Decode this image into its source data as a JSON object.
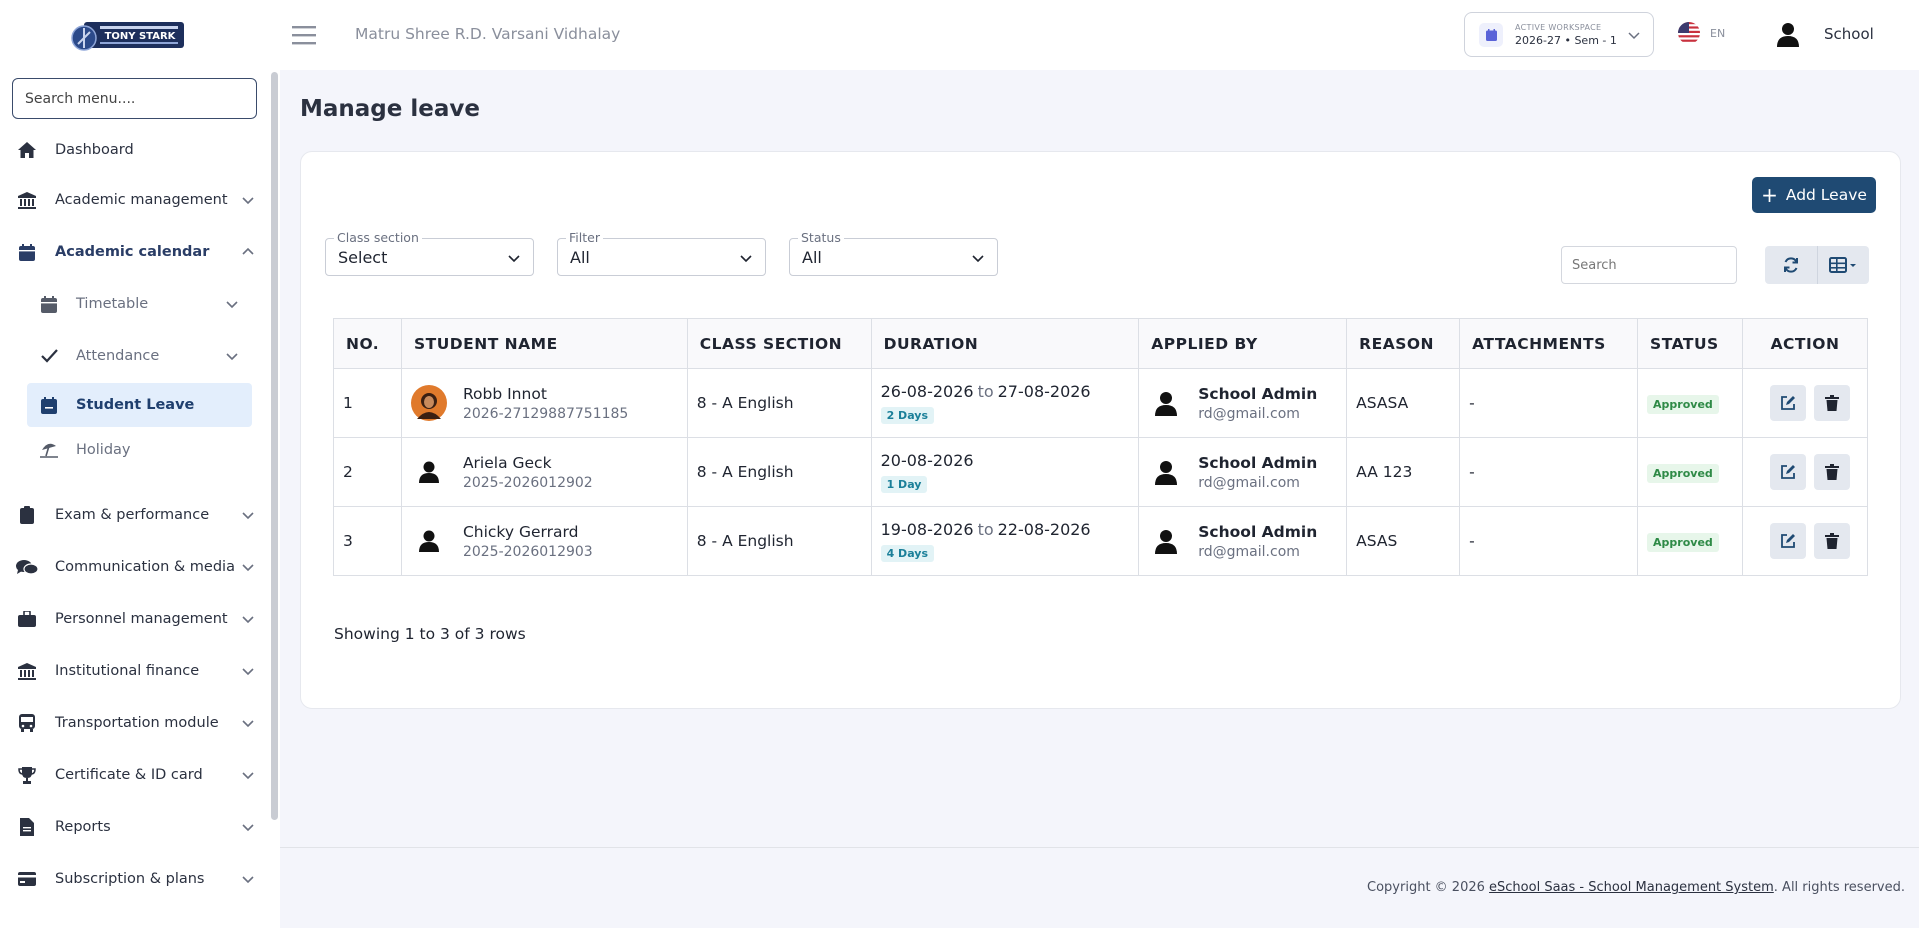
{
  "sidebar": {
    "logo_text": "TONY STARK",
    "search_placeholder": "Search menu....",
    "items": [
      {
        "label": "Dashboard",
        "icon": "home-icon"
      },
      {
        "label": "Academic management",
        "icon": "bank-icon"
      },
      {
        "label": "Academic calendar",
        "icon": "calendar-icon"
      },
      {
        "label": "Exam & performance",
        "icon": "clipboard-icon"
      },
      {
        "label": "Communication & media",
        "icon": "chat-icon"
      },
      {
        "label": "Personnel management",
        "icon": "briefcase-icon"
      },
      {
        "label": "Institutional finance",
        "icon": "bank-icon"
      },
      {
        "label": "Transportation module",
        "icon": "bus-icon"
      },
      {
        "label": "Certificate & ID card",
        "icon": "trophy-icon"
      },
      {
        "label": "Reports",
        "icon": "document-icon"
      },
      {
        "label": "Subscription & plans",
        "icon": "credit-card-icon"
      }
    ],
    "sub_items": [
      {
        "label": "Timetable",
        "icon": "calendar-icon"
      },
      {
        "label": "Attendance",
        "icon": "check-icon"
      },
      {
        "label": "Student Leave",
        "icon": "calendar-leave-icon"
      },
      {
        "label": "Holiday",
        "icon": "umbrella-beach-icon"
      }
    ]
  },
  "topbar": {
    "school_name": "Matru Shree R.D. Varsani Vidhalay",
    "workspace_label": "ACTIVE WORKSPACE",
    "workspace_value": "2026-27 • Sem - 1",
    "language": "EN",
    "user_name": "School"
  },
  "main": {
    "title": "Manage leave",
    "add_button": "Add Leave",
    "filters": [
      {
        "label": "Class section",
        "value": "Select"
      },
      {
        "label": "Filter",
        "value": "All"
      },
      {
        "label": "Status",
        "value": "All"
      }
    ],
    "search_placeholder": "Search",
    "columns": [
      "NO.",
      "STUDENT NAME",
      "CLASS SECTION",
      "DURATION",
      "APPLIED BY",
      "REASON",
      "ATTACHMENTS",
      "STATUS",
      "ACTION"
    ],
    "duration_to": "to",
    "rows": [
      {
        "no": "1",
        "name": "Robb Innot",
        "id": "2026-27129887751185",
        "class": "8 - A English",
        "from": "26-08-2026",
        "to": "27-08-2026",
        "days": "2 Days",
        "applied_name": "School Admin",
        "applied_email": "rd@gmail.com",
        "reason": "ASASA",
        "attachments": "-",
        "status": "Approved"
      },
      {
        "no": "2",
        "name": "Ariela Geck",
        "id": "2025-2026012902",
        "class": "8 - A English",
        "from": "20-08-2026",
        "to": "",
        "days": "1 Day",
        "applied_name": "School Admin",
        "applied_email": "rd@gmail.com",
        "reason": "AA 123",
        "attachments": "-",
        "status": "Approved"
      },
      {
        "no": "3",
        "name": "Chicky Gerrard",
        "id": "2025-2026012903",
        "class": "8 - A English",
        "from": "19-08-2026",
        "to": "22-08-2026",
        "days": "4 Days",
        "applied_name": "School Admin",
        "applied_email": "rd@gmail.com",
        "reason": "ASAS",
        "attachments": "-",
        "status": "Approved"
      }
    ],
    "showing": "Showing 1 to 3 of 3 rows"
  },
  "footer": {
    "prefix": "Copyright © 2026 ",
    "link": "eSchool Saas - School Management System",
    "suffix": ". All rights reserved."
  },
  "colors": {
    "primary": "#1f4a73",
    "active_bg": "#e3eefc",
    "approved": "#2e8a46"
  }
}
